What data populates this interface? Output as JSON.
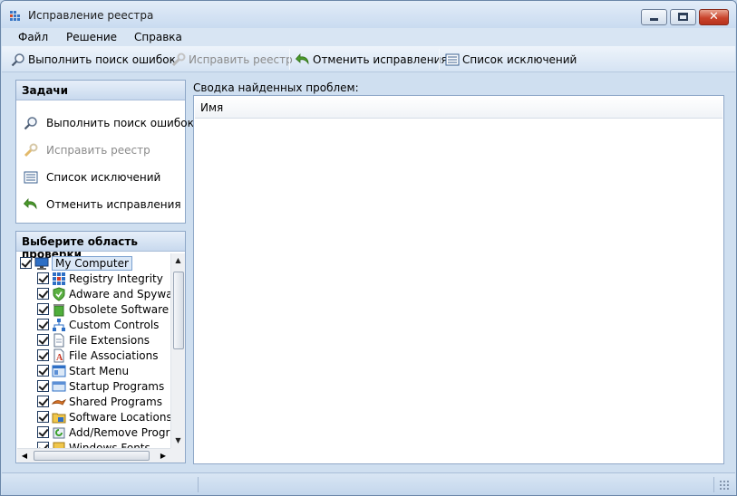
{
  "window": {
    "title": "Исправление реестра"
  },
  "menu": {
    "items": [
      "Файл",
      "Решение",
      "Справка"
    ]
  },
  "toolbar": {
    "scan_label": "Выполнить поиск ошибок",
    "fix_label": "Исправить реестр",
    "undo_label": "Отменить исправления",
    "exclusions_label": "Список исключений"
  },
  "tasks": {
    "header": "Задачи",
    "items": [
      {
        "label": "Выполнить поиск ошибок",
        "icon": "magnifier-icon",
        "enabled": true
      },
      {
        "label": "Исправить реестр",
        "icon": "wrench-icon",
        "enabled": false
      },
      {
        "label": "Список исключений",
        "icon": "list-icon",
        "enabled": true
      },
      {
        "label": "Отменить исправления",
        "icon": "undo-arrow-icon",
        "enabled": true
      }
    ]
  },
  "scan_area": {
    "header": "Выберите область проверки",
    "root": {
      "label": "My Computer",
      "checked": true,
      "icon": "computer-icon"
    },
    "items": [
      {
        "label": "Registry Integrity",
        "checked": true,
        "icon": "registry-icon"
      },
      {
        "label": "Adware and Spyware",
        "checked": true,
        "icon": "shield-icon"
      },
      {
        "label": "Obsolete Software",
        "checked": true,
        "icon": "recycle-bin-icon"
      },
      {
        "label": "Custom Controls",
        "checked": true,
        "icon": "network-icon"
      },
      {
        "label": "File Extensions",
        "checked": true,
        "icon": "file-icon"
      },
      {
        "label": "File Associations",
        "checked": true,
        "icon": "font-file-icon"
      },
      {
        "label": "Start Menu",
        "checked": true,
        "icon": "start-menu-icon"
      },
      {
        "label": "Startup Programs",
        "checked": true,
        "icon": "window-icon"
      },
      {
        "label": "Shared Programs",
        "checked": true,
        "icon": "shared-icon"
      },
      {
        "label": "Software Locations",
        "checked": true,
        "icon": "folder-icon"
      },
      {
        "label": "Add/Remove Programs",
        "checked": true,
        "icon": "install-icon"
      },
      {
        "label": "Windows Fonts",
        "checked": true,
        "icon": "fonts-icon"
      }
    ]
  },
  "results": {
    "summary_label": "Сводка найденных проблем:",
    "columns": [
      "Имя"
    ],
    "rows": []
  },
  "colors": {
    "window_bg": "#cfdff0",
    "panel_border": "#8fa8c8",
    "disabled_text": "#8b8b8b"
  }
}
